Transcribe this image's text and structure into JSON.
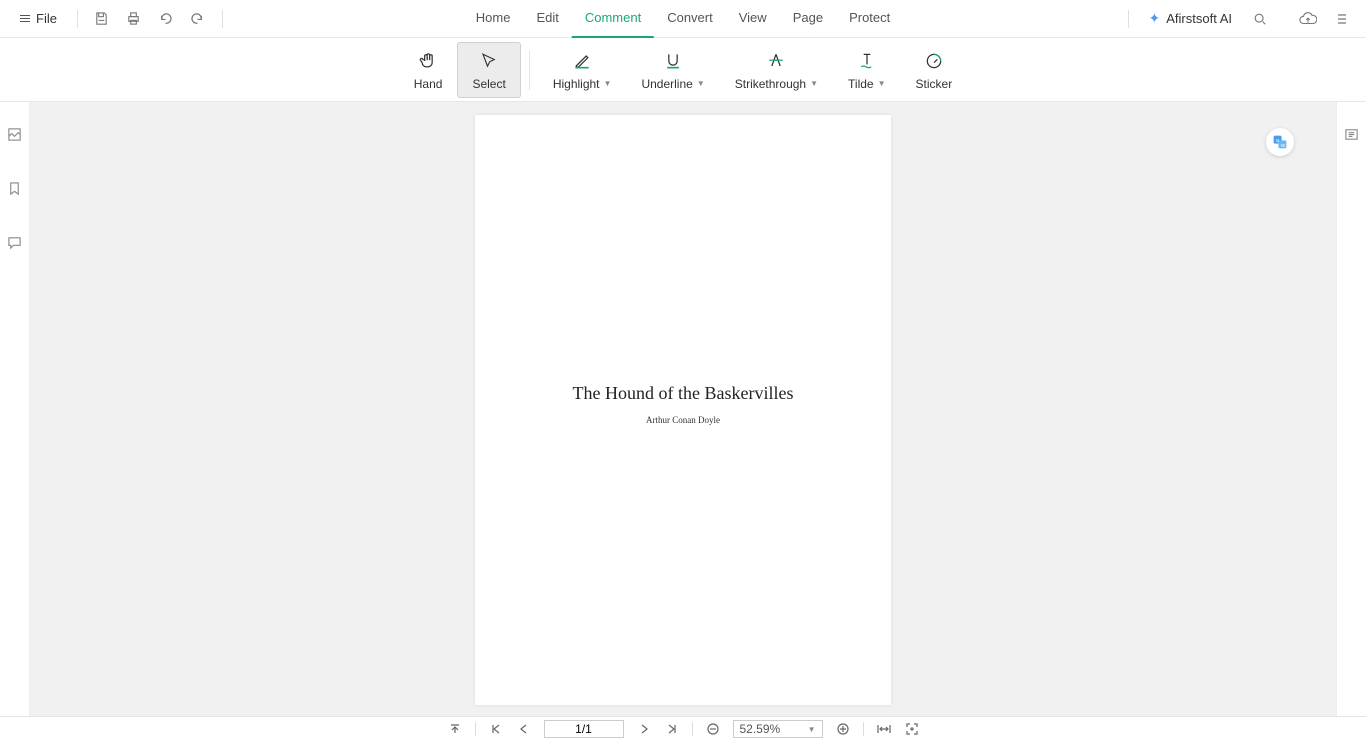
{
  "topBar": {
    "fileLabel": "File",
    "aiLabel": "Afirstsoft AI"
  },
  "tabs": {
    "home": "Home",
    "edit": "Edit",
    "comment": "Comment",
    "convert": "Convert",
    "view": "View",
    "page": "Page",
    "protect": "Protect"
  },
  "tools": {
    "hand": "Hand",
    "select": "Select",
    "highlight": "Highlight",
    "underline": "Underline",
    "strikethrough": "Strikethrough",
    "tilde": "Tilde",
    "sticker": "Sticker"
  },
  "document": {
    "title": "The Hound of the Baskervilles",
    "author": "Arthur Conan Doyle"
  },
  "statusBar": {
    "pageDisplay": "1/1",
    "zoomDisplay": "52.59%"
  }
}
